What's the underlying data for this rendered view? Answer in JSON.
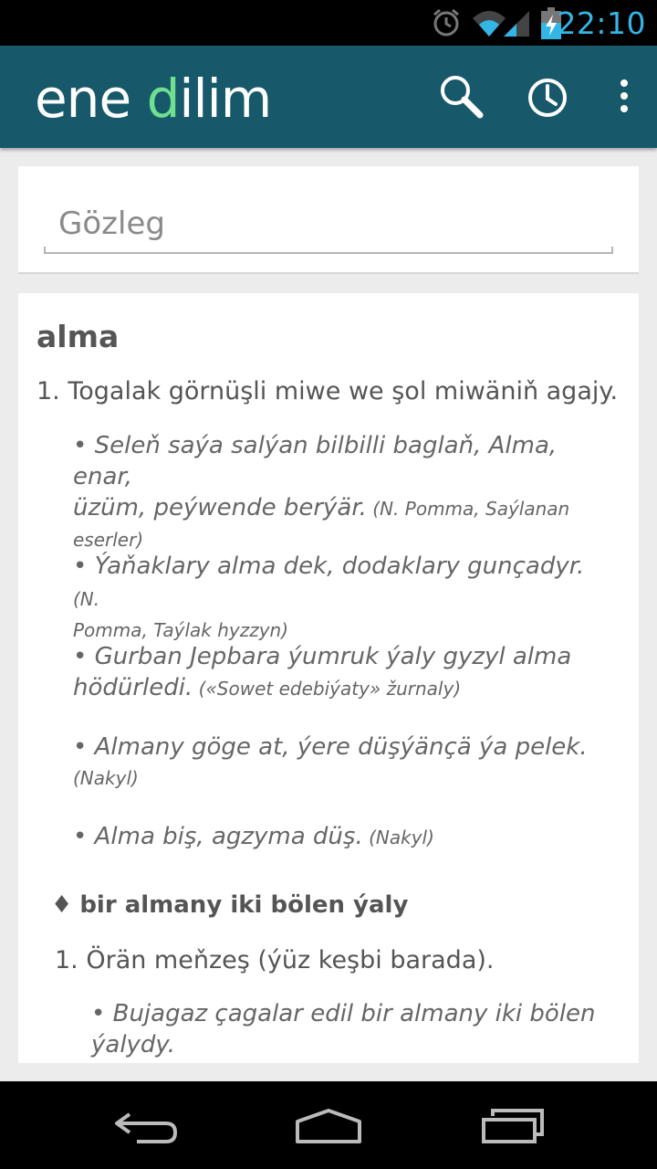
{
  "status_bar": {
    "time": "22:10",
    "icons": [
      "alarm-icon",
      "wifi-icon",
      "signal-icon",
      "battery-charging-icon"
    ]
  },
  "app_bar": {
    "logo_part1": "ene ",
    "logo_accent": "d",
    "logo_part2": "ilim",
    "accent_color": "#6ee08f",
    "bar_color": "#17596a",
    "actions": [
      "search-icon",
      "history-icon",
      "overflow-menu-icon"
    ]
  },
  "search": {
    "placeholder": "Gözleg",
    "value": ""
  },
  "entry": {
    "headword": "alma",
    "sense1": "1. Togalak görnüşli miwe we şol miwäniň agajy.",
    "examples": [
      {
        "line1": "• Seleň saýa salýan bilbilli baglaň, Alma, enar,",
        "line2": "üzüm, peýwende berýär.",
        "src2": " (N. Pomma, Saýlanan",
        "line3": "eserler)"
      },
      {
        "line1": "• Ýaňaklary alma dek, dodaklary gunçadyr.",
        "src1": " (N.",
        "line2": "Pomma, Taýlak hyzzyn)"
      },
      {
        "line1": "• Gurban Jepbara ýumruk ýaly gyzyl alma",
        "line2": "hödürledi.",
        "src2": " («Sowet edebiýaty» žurnaly)"
      },
      {
        "line1": "• Almany göge at, ýere düşýänçä ýa pelek.",
        "line2": "(Nakyl)"
      },
      {
        "line1": "• Alma biş, agzyma düş.",
        "src1": " (Nakyl)"
      }
    ],
    "phrase": {
      "bullet": "♦",
      "text": "bir almany iki bölen ýaly",
      "sense": "1. Örän meňzeş (ýüz keşbi barada).",
      "example_line1": "• Bujagaz çagalar edil bir almany iki bölen",
      "example_line2": "ýalydy."
    }
  },
  "nav_bar": {
    "buttons": [
      "back-icon",
      "home-icon",
      "recent-apps-icon"
    ]
  }
}
